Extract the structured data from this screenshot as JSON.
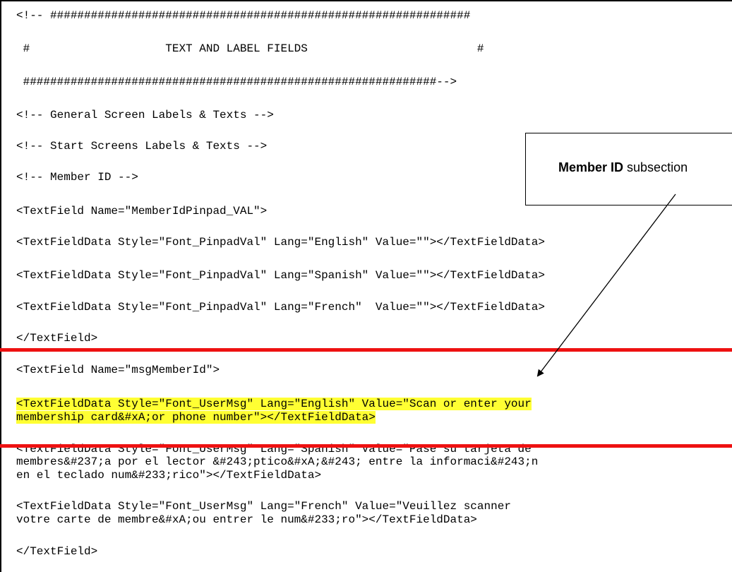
{
  "header": {
    "line1": "<!-- ##############################################################",
    "line2": " #                    TEXT AND LABEL FIELDS                         #",
    "line3": " #############################################################-->"
  },
  "comments": {
    "general": "<!-- General Screen Labels & Texts -->",
    "start_screens": "<!-- Start Screens Labels & Texts -->",
    "member_id": "<!-- Member ID -->"
  },
  "block1": {
    "open": "<TextField Name=\"MemberIdPinpad_VAL\">",
    "english": "<TextFieldData Style=\"Font_PinpadVal\" Lang=\"English\" Value=\"\"></TextFieldData>",
    "spanish": "<TextFieldData Style=\"Font_PinpadVal\" Lang=\"Spanish\" Value=\"\"></TextFieldData>",
    "french": "<TextFieldData Style=\"Font_PinpadVal\" Lang=\"French\"  Value=\"\"></TextFieldData>",
    "close": "</TextField>"
  },
  "block2": {
    "open": "<TextField Name=\"msgMemberId\">",
    "english_line1": "<TextFieldData Style=\"Font_UserMsg\" Lang=\"English\" Value=\"Scan or enter your",
    "english_line2": "membership card&#xA;or phone number\"></TextFieldData>",
    "spanish_line1": "<TextFieldData Style=\"Font_UserMsg\" Lang=\"Spanish\" Value=\"Pase su tarjeta de",
    "spanish_line2": "membres&#237;a por el lector &#243;ptico&#xA;&#243; entre la informaci&#243;n",
    "spanish_line3": "en el teclado num&#233;rico\"></TextFieldData>",
    "french_line1": "<TextFieldData Style=\"Font_UserMsg\" Lang=\"French\" Value=\"Veuillez scanner",
    "french_line2": "votre carte de membre&#xA;ou entrer le num&#233;ro\"></TextFieldData>",
    "close": "</TextField>"
  },
  "callout": {
    "bold": "Member ID",
    "rest": " subsection"
  },
  "colors": {
    "highlight": "#ffff33",
    "rule": "#ee1111"
  }
}
